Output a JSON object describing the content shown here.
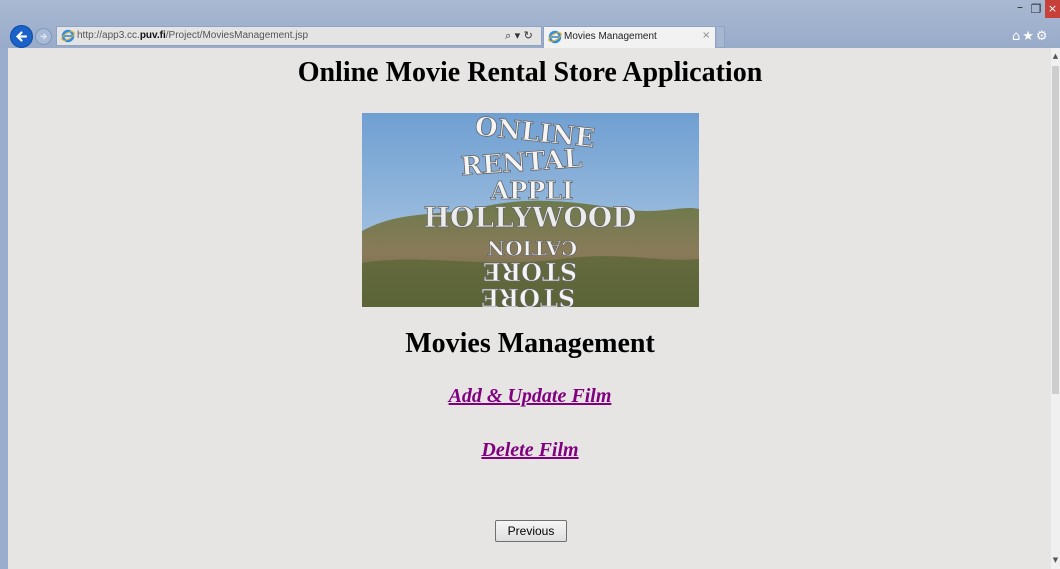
{
  "browser": {
    "url_prefix": "http://app3.cc.",
    "url_domain": "puv.fi",
    "url_path": "/Project/MoviesManagement.jsp",
    "tab_title": "Movies Management",
    "tab_close": "×",
    "address_tools": "⌕ ▾ ↻",
    "toolbar_icons": "⌂★⚙",
    "window_buttons": {
      "minimize": "–",
      "maximize": "❐",
      "close": "×"
    }
  },
  "page": {
    "title": "Online Movie Rental Store Application",
    "hero_text_lines": [
      "ONLINE",
      "RENTAL",
      "APPLI",
      "HOLLYWOOD",
      "CATION",
      "STORE",
      "STORE"
    ],
    "section_title": "Movies Management",
    "links": [
      {
        "label": "Add & Update Film"
      },
      {
        "label": "Delete Film"
      }
    ],
    "previous_button": "Previous"
  },
  "colors": {
    "page_bg": "#e6e5e4",
    "link": "#800080",
    "chrome": "#a9b9d3",
    "close_button": "#c7403a"
  }
}
